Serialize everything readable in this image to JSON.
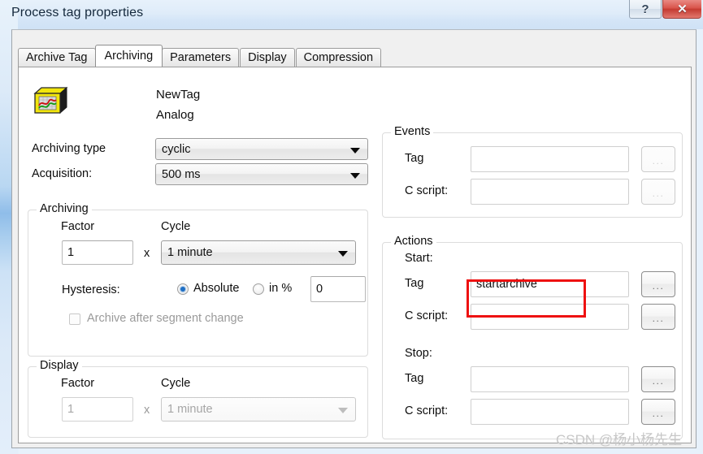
{
  "window": {
    "title": "Process tag properties",
    "help_button": "?",
    "close_button": "✕"
  },
  "tabs": [
    {
      "label": "Archive Tag",
      "active": false
    },
    {
      "label": "Archiving",
      "active": true
    },
    {
      "label": "Parameters",
      "active": false
    },
    {
      "label": "Display",
      "active": false
    },
    {
      "label": "Compression",
      "active": false
    }
  ],
  "header": {
    "icon": "archive-tag-icon",
    "tag_name": "NewTag",
    "tag_type": "Analog"
  },
  "left": {
    "archiving_type_label": "Archiving type",
    "archiving_type_value": "cyclic",
    "acquisition_label": "Acquisition:",
    "acquisition_value": "500 ms",
    "archiving_group": {
      "title": "Archiving",
      "factor_label": "Factor",
      "cycle_label": "Cycle",
      "factor_value": "1",
      "multiply_symbol": "x",
      "cycle_value": "1 minute",
      "hysteresis_label": "Hysteresis:",
      "absolute_label": "Absolute",
      "absolute_selected": true,
      "percent_label": "in %",
      "percent_selected": false,
      "hysteresis_value": "0",
      "segment_checkbox_label": "Archive after segment change",
      "segment_checkbox_checked": false
    },
    "display_group": {
      "title": "Display",
      "factor_label": "Factor",
      "cycle_label": "Cycle",
      "factor_value": "1",
      "multiply_symbol": "x",
      "cycle_value": "1 minute"
    }
  },
  "right": {
    "events_group": {
      "title": "Events",
      "tag_label": "Tag",
      "tag_value": "",
      "cscript_label": "C script:",
      "cscript_value": "",
      "browse_button": "..."
    },
    "actions_group": {
      "title": "Actions",
      "start_label": "Start:",
      "start_tag_label": "Tag",
      "start_tag_value": "startarchive",
      "start_cscript_label": "C script:",
      "start_cscript_value": "",
      "stop_label": "Stop:",
      "stop_tag_label": "Tag",
      "stop_tag_value": "",
      "stop_cscript_label": "C script:",
      "stop_cscript_value": "",
      "browse_button": "..."
    }
  },
  "annotation": {
    "color": "#ee1111",
    "target": "start-tag-input"
  },
  "watermark": {
    "text": "CSDN @杨小杨先生"
  }
}
